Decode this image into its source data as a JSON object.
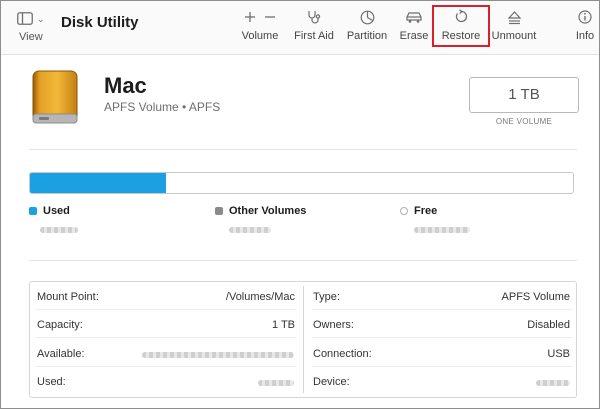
{
  "toolbar": {
    "view_label": "View",
    "app_title": "Disk Utility",
    "buttons": {
      "volume": "Volume",
      "first_aid": "First Aid",
      "partition": "Partition",
      "erase": "Erase",
      "restore": "Restore",
      "unmount": "Unmount",
      "info": "Info"
    },
    "highlight_color": "#d9202a"
  },
  "disk": {
    "name": "Mac",
    "subtitle": "APFS Volume • APFS",
    "capacity": "1 TB",
    "capacity_caption": "ONE VOLUME"
  },
  "usage": {
    "used_fraction": 0.25,
    "legend": {
      "used": "Used",
      "other_volumes": "Other Volumes",
      "free": "Free"
    },
    "colors": {
      "used": "#1ba1e2",
      "other_volumes": "#8a8a8a",
      "free": "#ffffff"
    }
  },
  "info": {
    "left": [
      {
        "label": "Mount Point:",
        "value": "/Volumes/Mac"
      },
      {
        "label": "Capacity:",
        "value": "1 TB"
      },
      {
        "label": "Available:",
        "value": ""
      },
      {
        "label": "Used:",
        "value": ""
      }
    ],
    "right": [
      {
        "label": "Type:",
        "value": "APFS Volume"
      },
      {
        "label": "Owners:",
        "value": "Disabled"
      },
      {
        "label": "Connection:",
        "value": "USB"
      },
      {
        "label": "Device:",
        "value": ""
      }
    ]
  },
  "icons": {
    "view": "sidebar-icon",
    "volume": "plus-minus-icon",
    "first_aid": "stethoscope-icon",
    "partition": "pie-icon",
    "erase": "car-icon",
    "restore": "restore-arrow-icon",
    "unmount": "eject-icon",
    "info": "info-icon",
    "disk": "external-drive-icon"
  }
}
